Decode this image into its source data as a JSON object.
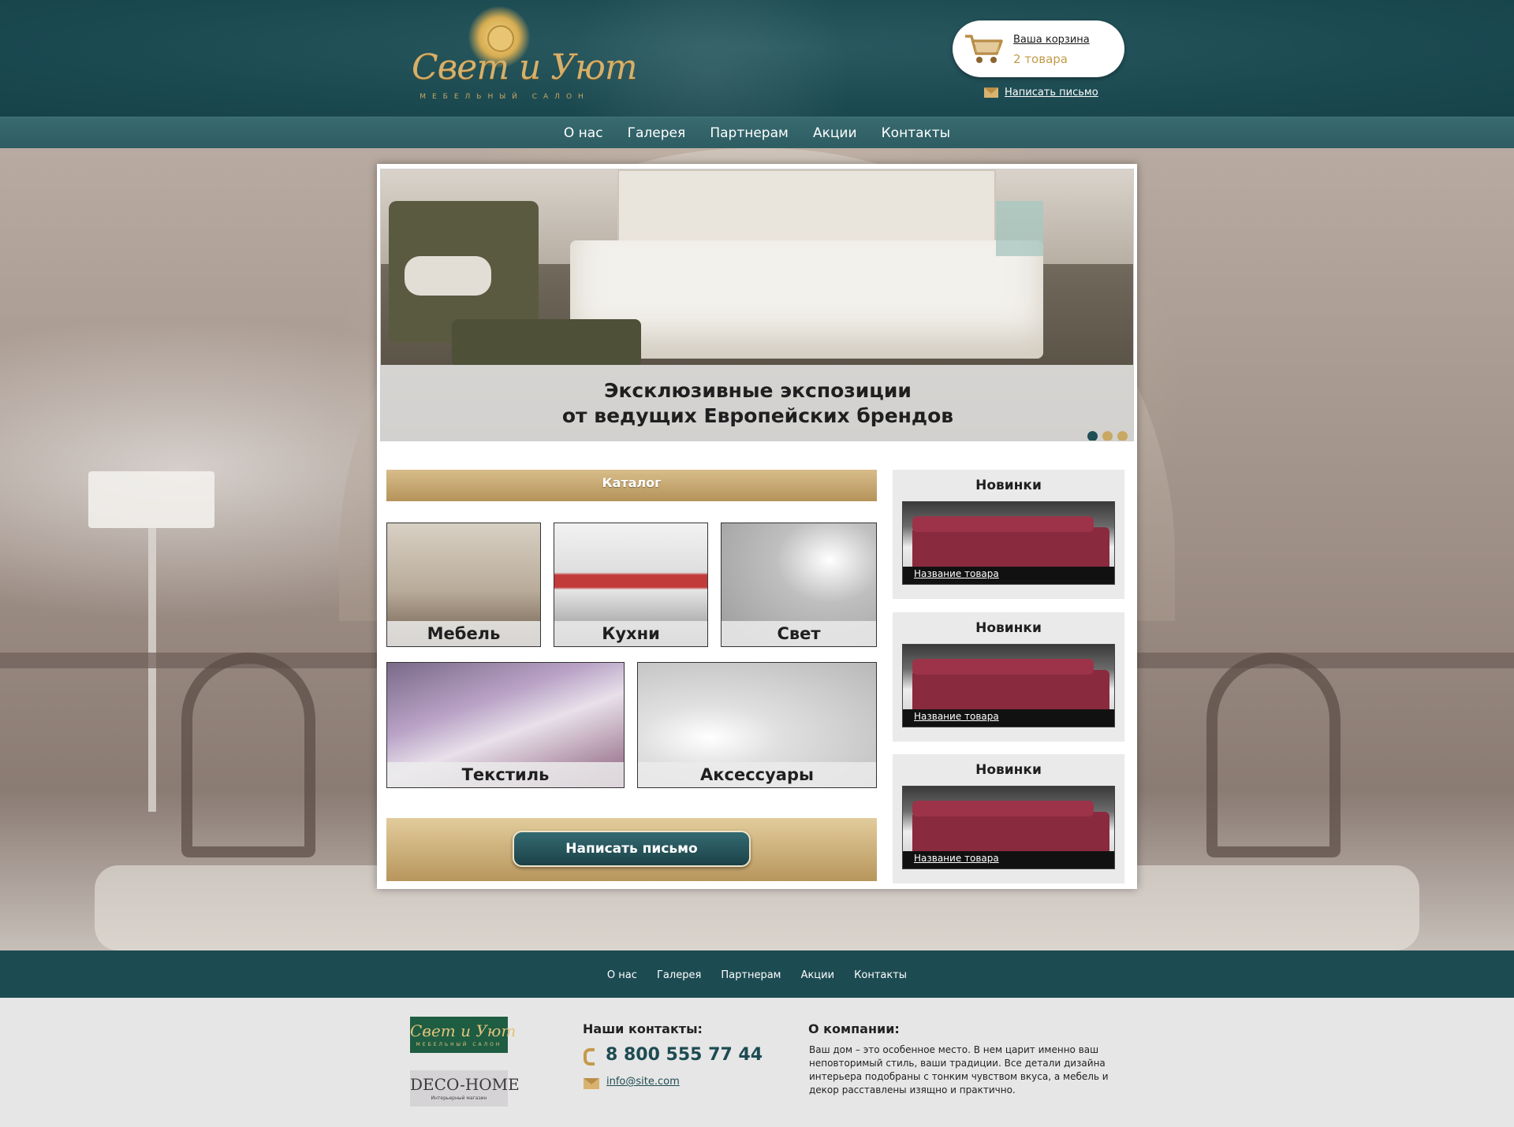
{
  "header": {
    "logo_title": "Свет и Уют",
    "logo_subtitle": "МЕБЕЛЬНЫЙ САЛОН",
    "cart_link": "Ваша корзина",
    "cart_count": "2 товара",
    "mail_link": "Написать письмо"
  },
  "nav": {
    "items": [
      {
        "label": "О нас"
      },
      {
        "label": "Галерея"
      },
      {
        "label": "Партнерам"
      },
      {
        "label": "Акции"
      },
      {
        "label": "Контакты"
      }
    ]
  },
  "slider": {
    "caption_line1": "Эксклюзивные экспозиции",
    "caption_line2": "от ведущих Европейских брендов",
    "active_dot": 1
  },
  "catalog": {
    "title": "Каталог",
    "tiles": [
      {
        "label": "Мебель"
      },
      {
        "label": "Кухни"
      },
      {
        "label": "Свет"
      },
      {
        "label": "Текстиль"
      },
      {
        "label": "Аксессуары"
      }
    ],
    "write_button": "Написать письмо"
  },
  "news": [
    {
      "title": "Новинки",
      "product": "Название товара"
    },
    {
      "title": "Новинки",
      "product": "Название товара"
    },
    {
      "title": "Новинки",
      "product": "Название товара"
    }
  ],
  "footer_nav": {
    "items": [
      {
        "label": "О нас"
      },
      {
        "label": "Галерея"
      },
      {
        "label": "Партнерам"
      },
      {
        "label": "Акции"
      },
      {
        "label": "Контакты"
      }
    ]
  },
  "footer": {
    "logo1_title": "Свет и Уют",
    "logo1_sub": "МЕБЕЛЬНЫЙ САЛОН",
    "logo2_title": "DECO-HOME",
    "logo2_sub": "Интерьерный магазин",
    "contacts_title": "Наши контакты:",
    "phone": "8 800 555 77 44",
    "email": "info@site.com",
    "about_title": "О компании:",
    "about_text": "Ваш дом – это особенное место. В нем царит именно ваш неповторимый стиль, ваши традиции. Все детали дизайна интерьера подобраны с тонким чувством вкуса, а мебель и декор расставлены изящно и практично."
  },
  "colors": {
    "primary_teal": "#1d4b52",
    "accent_gold": "#c49a4a",
    "panel_bg": "#ffffff"
  }
}
